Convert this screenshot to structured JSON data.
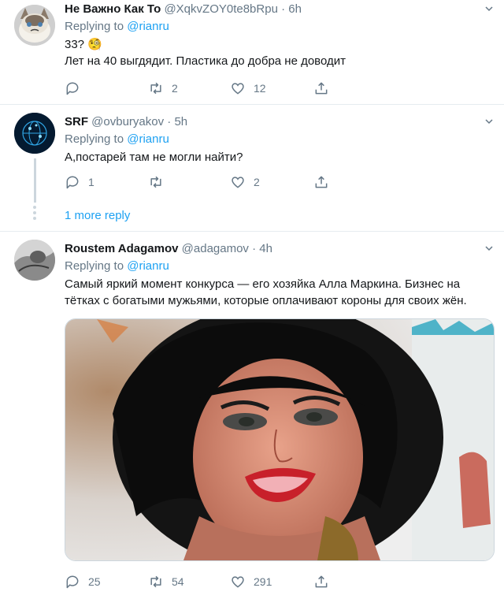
{
  "tweets": [
    {
      "name": "Не Важно Как То",
      "handle": "@XqkvZOY0te8bRpu",
      "time": "6h",
      "replying_label": "Replying to",
      "replying_to": "@rianru",
      "text_lines": [
        "33? 🧐",
        "Лет на 40 выгдядит. Пластика до добра не доводит"
      ],
      "reply_count": "",
      "retweet_count": "2",
      "like_count": "12"
    },
    {
      "name": "SRF",
      "handle": "@ovburyakov",
      "time": "5h",
      "replying_label": "Replying to",
      "replying_to": "@rianru",
      "text_lines": [
        "А,постарей там не могли найти?"
      ],
      "reply_count": "1",
      "retweet_count": "",
      "like_count": "2"
    },
    {
      "name": "Roustem Adagamov",
      "handle": "@adagamov",
      "time": "4h",
      "replying_label": "Replying to",
      "replying_to": "@rianru",
      "text_lines": [
        "Самый яркий момент конкурса — его хозяйка Алла Маркина. Бизнес на",
        "тётках с богатыми мужьями, которые оплачивают короны для своих жён."
      ],
      "reply_count": "25",
      "retweet_count": "54",
      "like_count": "291"
    }
  ],
  "more_replies": "1 more reply",
  "icons": {
    "reply": "reply-icon",
    "retweet": "retweet-icon",
    "like": "heart-icon",
    "share": "share-icon",
    "caret": "chevron-down-icon"
  },
  "colors": {
    "link": "#1da1f2",
    "muted": "#657786",
    "border": "#e6ecf0"
  }
}
